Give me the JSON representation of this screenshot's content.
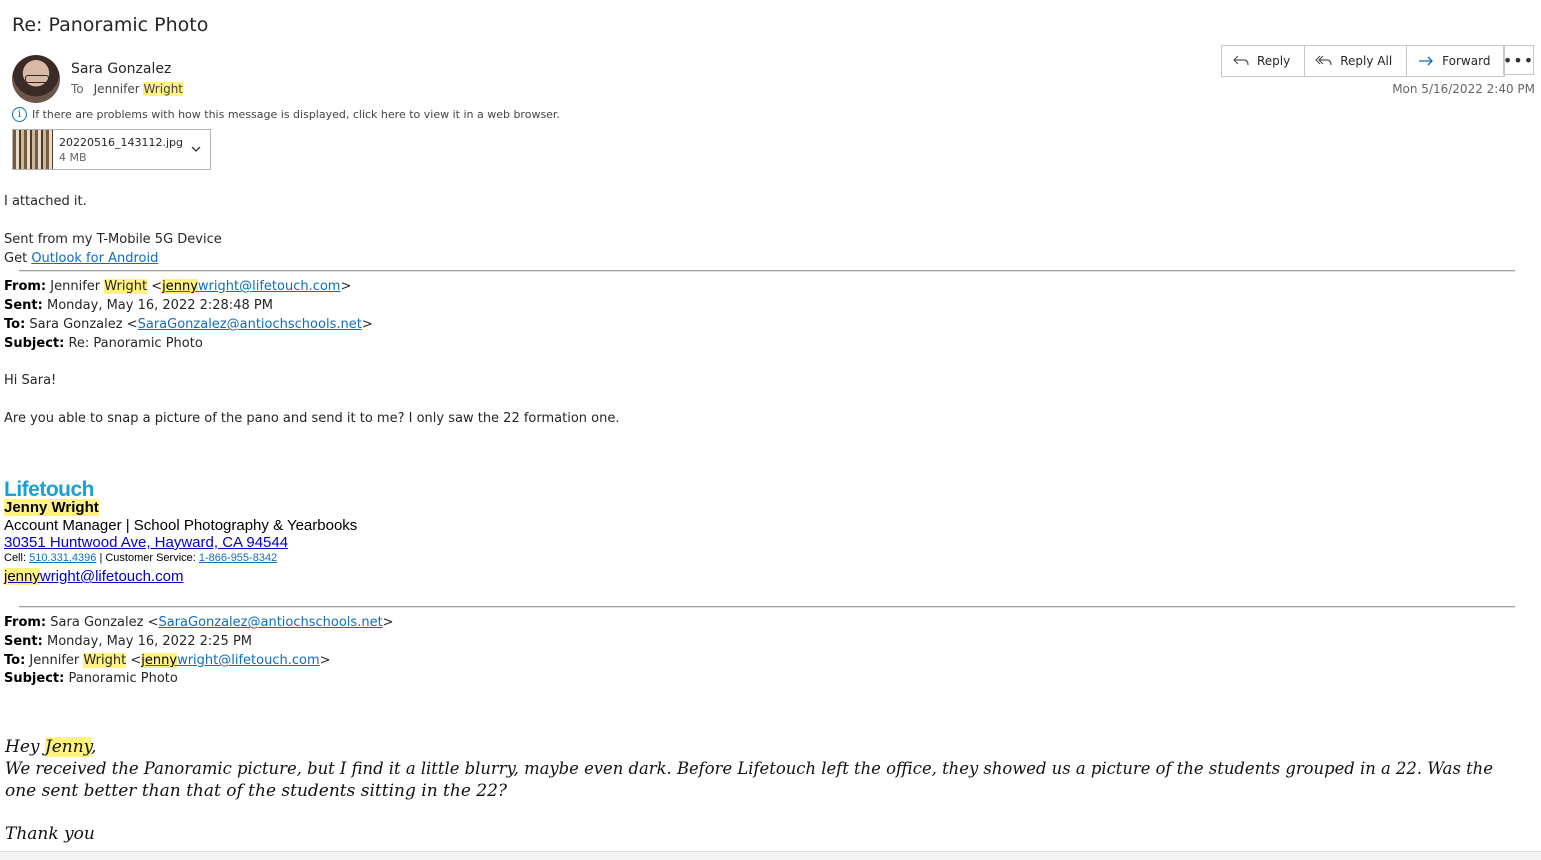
{
  "message": {
    "subject": "Re: Panoramic Photo",
    "sender": "Sara Gonzalez",
    "to_label": "To",
    "to_first": "Jennifer",
    "to_last": "Wright",
    "date": "Mon 5/16/2022 2:40 PM",
    "info_bar": "If there are problems with how this message is displayed, click here to view it in a web browser."
  },
  "actions": {
    "reply": "Reply",
    "reply_all": "Reply All",
    "forward": "Forward",
    "more": "•••"
  },
  "attachment": {
    "name": "20220516_143112.jpg",
    "size": "4 MB"
  },
  "body": {
    "line1": "I attached it.",
    "sent_from": "Sent from my T-Mobile 5G Device",
    "get": "Get",
    "outlook_link": "Outlook for Android"
  },
  "reply1": {
    "from_label": "From:",
    "from_name_first": "Jennifer",
    "from_name_last": "Wright",
    "from_email_hl": "jenny",
    "from_email_rest": "wright@lifetouch.com",
    "sent_label": "Sent:",
    "sent": "Monday, May 16, 2022 2:28:48 PM",
    "to_label": "To:",
    "to_name": "Sara Gonzalez",
    "to_email": "SaraGonzalez@antiochschools.net",
    "subject_label": "Subject:",
    "subject": "Re: Panoramic Photo",
    "greeting": "Hi Sara!",
    "text": "Are you able to snap a picture of the pano and send it to me? I only saw the 22 formation one."
  },
  "signature": {
    "logo": "Lifetouch",
    "name": "Jenny Wright",
    "title": "Account Manager | School Photography & Yearbooks",
    "address": "30351 Huntwood Ave, Hayward, CA 94544",
    "cell_label": "Cell:",
    "cell": "510.331.4396",
    "cs_label": "| Customer Service:",
    "cs": "1-866-955-8342",
    "email_hl": "jenny",
    "email_rest": "wright@lifetouch.com"
  },
  "reply2": {
    "from_label": "From:",
    "from_name": "Sara Gonzalez",
    "from_email": "SaraGonzalez@antiochschools.net",
    "sent_label": "Sent:",
    "sent": "Monday, May 16, 2022 2:25 PM",
    "to_label": "To:",
    "to_first": "Jennifer",
    "to_last": "Wright",
    "to_email_hl": "jenny",
    "to_email_rest": "wright@lifetouch.com",
    "subject_label": "Subject:",
    "subject": "Panoramic Photo",
    "greeting_pre": "Hey",
    "greeting_name": "Jenny",
    "line1": "We received the Panoramic picture, but I find it a little blurry, maybe even dark. Before Lifetouch left the office, they showed us a picture of the students grouped in a 22. Was the",
    "line2": "one sent better than that of the students sitting in the 22?",
    "thanks": "Thank you"
  },
  "colors": {
    "accent": "#0f6cbd",
    "highlight": "#fff280",
    "logo": "#1aa0d8"
  }
}
